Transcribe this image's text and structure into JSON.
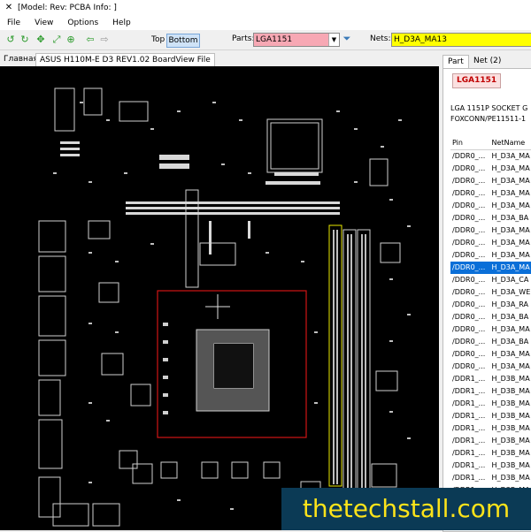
{
  "window": {
    "title": "[Model: Rev:  PCBA Info: ]"
  },
  "menu": [
    "File",
    "View",
    "Options",
    "Help"
  ],
  "toolbar": {
    "top_label": "Top",
    "bottom_label": "Bottom",
    "parts_label": "Parts:",
    "parts_value": "LGA1151",
    "nets_label": "Nets:",
    "nets_value": "H_D3A_MA13",
    "icons": [
      "rotate-left-icon",
      "rotate-right-icon",
      "zoom-fit-icon",
      "zoom-in-icon",
      "zoom-out-icon",
      "arrow-left-icon",
      "arrow-right-icon",
      "filter-icon"
    ]
  },
  "tabs": [
    "Главная",
    "ASUS H110M-E D3 REV1.02 BoardView File"
  ],
  "panel": {
    "tabs": [
      "Part",
      "Net (2)"
    ],
    "part_name": "LGA1151",
    "desc_line1": "LGA 1151P SOCKET G",
    "desc_line2": "FOXCONN/PE11511-1",
    "columns": [
      "Pin",
      "NetName"
    ],
    "rows": [
      [
        "/DDR0_...",
        "H_D3A_MA"
      ],
      [
        "/DDR0_...",
        "H_D3A_MA"
      ],
      [
        "/DDR0_...",
        "H_D3A_MA"
      ],
      [
        "/DDR0_...",
        "H_D3A_MA"
      ],
      [
        "/DDR0_...",
        "H_D3A_MA"
      ],
      [
        "/DDR0_...",
        "H_D3A_BA"
      ],
      [
        "/DDR0_...",
        "H_D3A_MA"
      ],
      [
        "/DDR0_...",
        "H_D3A_MA"
      ],
      [
        "/DDR0_...",
        "H_D3A_MA"
      ],
      [
        "/DDR0_...",
        "H_D3A_MA"
      ],
      [
        "/DDR0_...",
        "H_D3A_CA"
      ],
      [
        "/DDR0_...",
        "H_D3A_WE"
      ],
      [
        "/DDR0_...",
        "H_D3A_RA"
      ],
      [
        "/DDR0_...",
        "H_D3A_BA"
      ],
      [
        "/DDR0_...",
        "H_D3A_MA"
      ],
      [
        "/DDR0_...",
        "H_D3A_BA"
      ],
      [
        "/DDR0_...",
        "H_D3A_MA"
      ],
      [
        "/DDR0_...",
        "H_D3A_MA"
      ],
      [
        "/DDR1_...",
        "H_D3B_MA"
      ],
      [
        "/DDR1_...",
        "H_D3B_MA"
      ],
      [
        "/DDR1_...",
        "H_D3B_MA"
      ],
      [
        "/DDR1_...",
        "H_D3B_MA"
      ],
      [
        "/DDR1_...",
        "H_D3B_MA"
      ],
      [
        "/DDR1_...",
        "H_D3B_MA"
      ],
      [
        "/DDR1_...",
        "H_D3B_MA"
      ],
      [
        "/DDR1_...",
        "H_D3B_MA"
      ],
      [
        "/DDR1_...",
        "H_D3B_MA"
      ],
      [
        "/DDR1_...",
        "H_D3B_MA"
      ],
      [
        "/DDR1_...",
        "H_D3B_MA"
      ],
      [
        "/DDR1_...",
        "H_D3B_MA"
      ]
    ],
    "selected_row": 9
  },
  "watermark": "thetechstall.com",
  "colors": {
    "board_bg": "#000000",
    "trace": "#e0e0e0",
    "highlight_rect": "#d01515",
    "ram_slot": "#e8e800",
    "selection": "#0a6fd8"
  }
}
